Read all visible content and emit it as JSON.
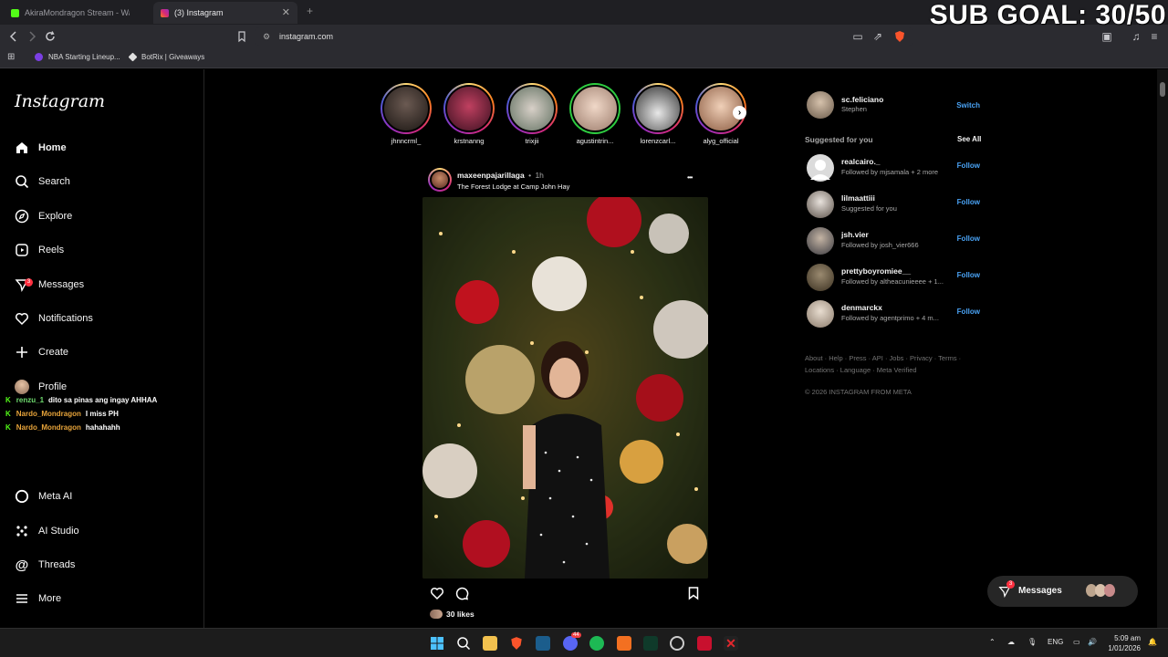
{
  "browser": {
    "tabs": [
      {
        "label": "AkiraMondragon Stream - Watch",
        "active": false
      },
      {
        "label": "(3) Instagram",
        "active": true
      }
    ],
    "url": "instagram.com",
    "bookmarks": [
      "NBA Starting Lineup...",
      "BotRix | Giveaways"
    ]
  },
  "overlay": {
    "sub_goal": "SUB GOAL: 30/50"
  },
  "sidebar": {
    "logo": "Instagram",
    "items": [
      {
        "label": "Home",
        "icon": "home-icon"
      },
      {
        "label": "Search",
        "icon": "search-icon"
      },
      {
        "label": "Explore",
        "icon": "compass-icon"
      },
      {
        "label": "Reels",
        "icon": "reels-icon"
      },
      {
        "label": "Messages",
        "icon": "messenger-icon",
        "badge": "3"
      },
      {
        "label": "Notifications",
        "icon": "heart-icon"
      },
      {
        "label": "Create",
        "icon": "plus-icon"
      },
      {
        "label": "Profile",
        "icon": "avatar-icon"
      },
      {
        "label": "Meta AI",
        "icon": "meta-ai-icon"
      },
      {
        "label": "AI Studio",
        "icon": "ai-studio-icon"
      },
      {
        "label": "Threads",
        "icon": "threads-icon"
      },
      {
        "label": "More",
        "icon": "menu-icon"
      }
    ]
  },
  "chat": [
    {
      "user": "renzu_1",
      "text": "dito sa pinas ang ingay AHHAA"
    },
    {
      "user": "Nardo_Mondragon",
      "text": "I miss PH"
    },
    {
      "user": "Nardo_Mondragon",
      "text": "hahahahh"
    }
  ],
  "stories": [
    "jhnncrml_",
    "krstnanng",
    "trixjii",
    "agustintrin...",
    "lorenzcarl...",
    "alyg_official"
  ],
  "post": {
    "username": "maxeenpajarillaga",
    "dot": "•",
    "time": "1h",
    "location": "The Forest Lodge at Camp John Hay",
    "more": "•••",
    "likes": "30 likes"
  },
  "right": {
    "me": {
      "username": "sc.feliciano",
      "name": "Stephen",
      "action": "Switch"
    },
    "suggested_title": "Suggested for you",
    "see_all": "See All",
    "suggestions": [
      {
        "username": "realcairo._",
        "sub": "Followed by mjsamala + 2 more",
        "action": "Follow"
      },
      {
        "username": "lilmaattiii",
        "sub": "Suggested for you",
        "action": "Follow"
      },
      {
        "username": "jsh.vier",
        "sub": "Followed by josh_vier666",
        "action": "Follow"
      },
      {
        "username": "prettyboyromiee__",
        "sub": "Followed by altheacunieeee + 1...",
        "action": "Follow"
      },
      {
        "username": "denmarckx",
        "sub": "Followed by agentprimo + 4 m...",
        "action": "Follow"
      }
    ],
    "footer_line1": "About · Help · Press · API · Jobs · Privacy · Terms ·",
    "footer_line2": "Locations · Language · Meta Verified",
    "copyright": "© 2026 INSTAGRAM FROM META"
  },
  "messages_pill": {
    "label": "Messages",
    "badge": "3"
  },
  "taskbar": {
    "lang": "ENG",
    "time": "5:09 am",
    "date": "1/01/2026",
    "discord_badge": "44"
  }
}
